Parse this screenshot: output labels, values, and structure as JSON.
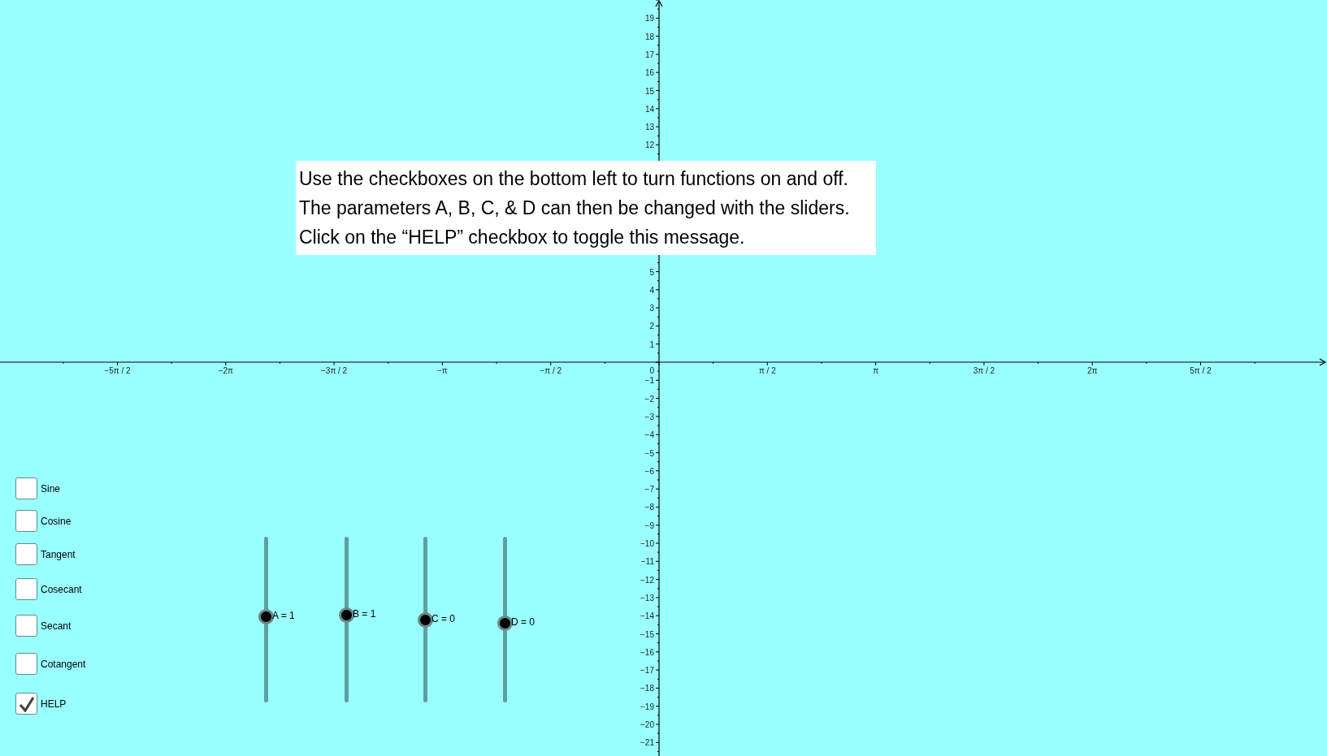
{
  "graph": {
    "x_labels": [
      "−5π / 2",
      "−2π",
      "−3π / 2",
      "−π",
      "−π / 2",
      "π / 2",
      "π",
      "3π / 2",
      "2π",
      "5π / 2"
    ],
    "origin_label": "0",
    "y_labels_upper": [
      "19",
      "18",
      "17",
      "16",
      "15",
      "14",
      "13",
      "12"
    ],
    "y_labels_middle": [
      "5",
      "4",
      "3",
      "2",
      "1"
    ],
    "y_labels_lower": [
      "−1",
      "−2",
      "−3",
      "−4",
      "−5",
      "−6",
      "−7",
      "−8",
      "−9",
      "−10",
      "−11",
      "−12",
      "−13",
      "−14",
      "−15",
      "−16",
      "−17",
      "−18",
      "−19",
      "−20",
      "−21"
    ]
  },
  "help_message": [
    "Use the checkboxes on the bottom left to turn functions on and off.",
    "The parameters A, B, C, & D can then be changed with the sliders.",
    "Click on the “HELP” checkbox to toggle this message."
  ],
  "checkboxes": [
    {
      "label": "Sine",
      "checked": false,
      "kind": "function"
    },
    {
      "label": "Cosine",
      "checked": false,
      "kind": "function"
    },
    {
      "label": "Tangent",
      "checked": false,
      "kind": "function"
    },
    {
      "label": "Cosecant",
      "checked": false,
      "kind": "function"
    },
    {
      "label": "Secant",
      "checked": false,
      "kind": "function"
    },
    {
      "label": "Cotangent",
      "checked": false,
      "kind": "function"
    },
    {
      "label": "HELP",
      "checked": true,
      "kind": "help"
    }
  ],
  "sliders": [
    {
      "label": "A = 1",
      "level": 0.52
    },
    {
      "label": "B = 1",
      "level": 0.53
    },
    {
      "label": "C = 0",
      "level": 0.5
    },
    {
      "label": "D = 0",
      "level": 0.48
    }
  ]
}
